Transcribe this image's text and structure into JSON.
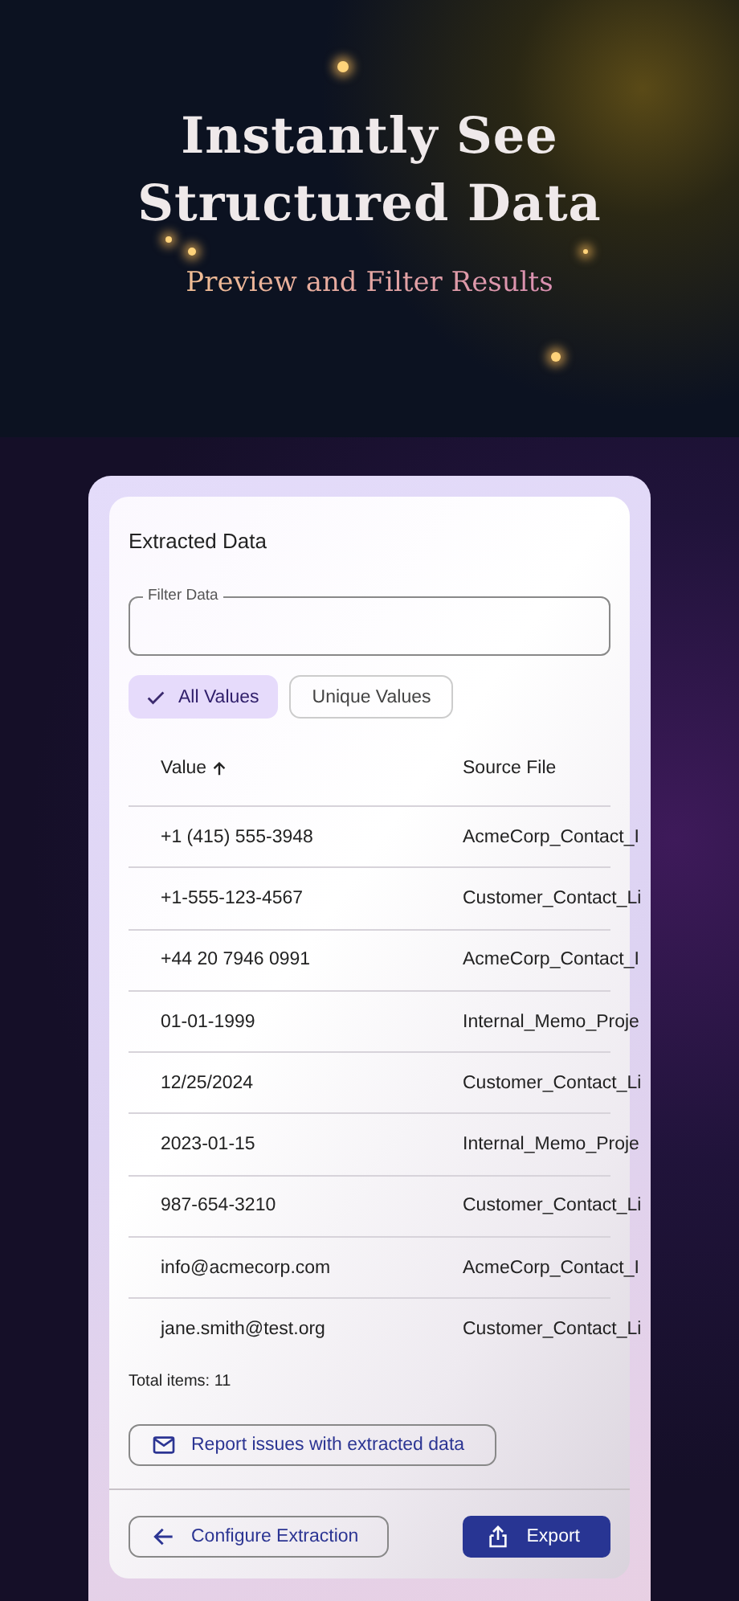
{
  "hero": {
    "title_lines": [
      "Instantly See",
      "Structured Data"
    ],
    "subtitle": "Preview and Filter Results"
  },
  "panel": {
    "title": "Extracted Data",
    "filter": {
      "label": "Filter Data"
    },
    "chips": [
      {
        "label": "All Values",
        "selected": true
      },
      {
        "label": "Unique Values",
        "selected": false
      }
    ],
    "table": {
      "columns": [
        {
          "label": "Value",
          "sorted": true
        },
        {
          "label": "Source File",
          "sorted": false
        }
      ],
      "rows": [
        [
          "+1 (415) 555-3948",
          "AcmeCorp_Contact_I"
        ],
        [
          "+1-555-123-4567",
          "Customer_Contact_Li"
        ],
        [
          "+44 20 7946 0991",
          "AcmeCorp_Contact_I"
        ],
        [
          "01-01-1999",
          "Internal_Memo_Proje"
        ],
        [
          "12/25/2024",
          "Customer_Contact_Li"
        ],
        [
          "2023-01-15",
          "Internal_Memo_Proje"
        ],
        [
          "987-654-3210",
          "Customer_Contact_Li"
        ],
        [
          "info@acmecorp.com",
          "AcmeCorp_Contact_I"
        ],
        [
          "jane.smith@test.org",
          "Customer_Contact_Li"
        ]
      ]
    },
    "total": "Total items: 11",
    "report_button": "Report issues with extracted data",
    "back_button": "Configure Extraction",
    "export_button": "Export"
  }
}
